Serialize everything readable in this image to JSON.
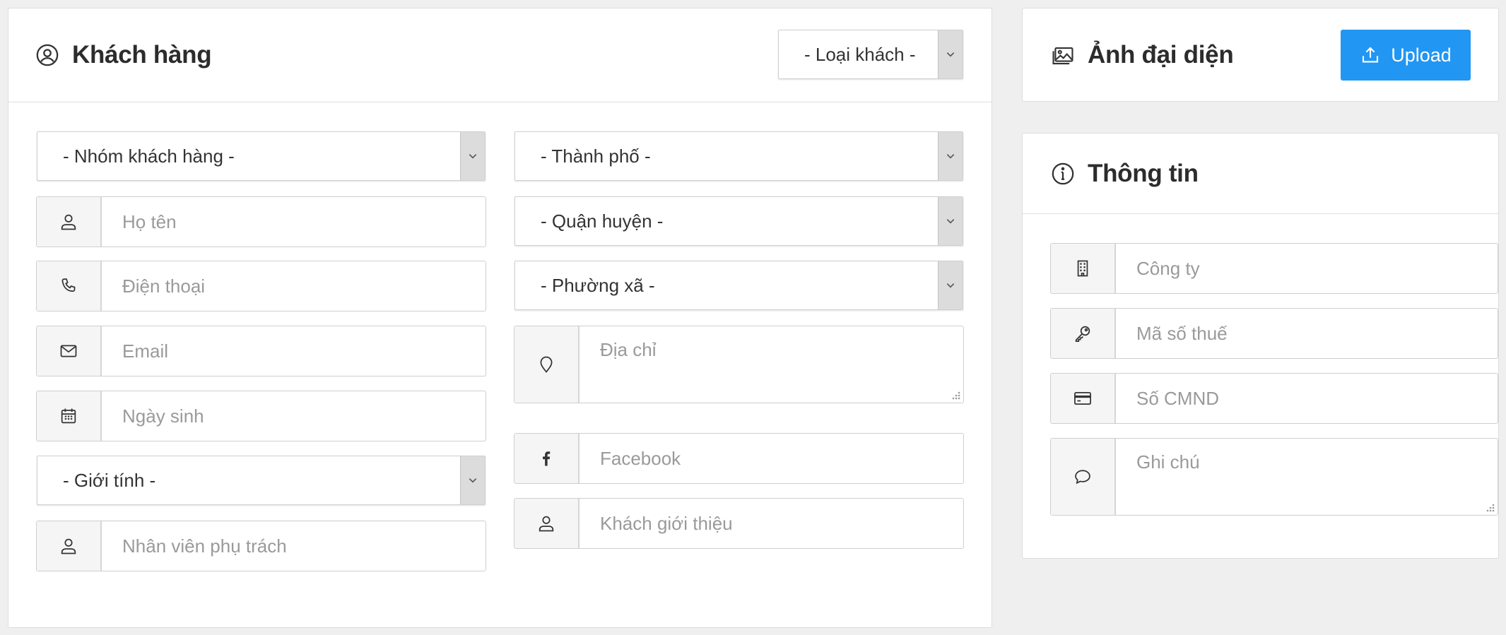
{
  "customer": {
    "title": "Khách hàng",
    "type_select": "- Loại khách -",
    "group_select": "- Nhóm khách hàng -",
    "name_placeholder": "Họ tên",
    "phone_placeholder": "Điện thoại",
    "email_placeholder": "Email",
    "birthday_placeholder": "Ngày sinh",
    "gender_select": "- Giới tính -",
    "staff_placeholder": "Nhân viên phụ trách",
    "city_select": "- Thành phố -",
    "district_select": "- Quận huyện -",
    "ward_select": "- Phường xã -",
    "address_placeholder": "Địa chỉ",
    "facebook_placeholder": "Facebook",
    "referrer_placeholder": "Khách giới thiệu"
  },
  "avatar": {
    "title": "Ảnh đại diện",
    "upload_label": "Upload"
  },
  "info": {
    "title": "Thông tin",
    "company_placeholder": "Công ty",
    "tax_placeholder": "Mã số thuế",
    "id_placeholder": "Số CMND",
    "note_placeholder": "Ghi chú"
  },
  "colors": {
    "accent": "#2196f3",
    "background": "#efefef"
  },
  "icons": [
    "user-circle-icon",
    "user-icon",
    "phone-icon",
    "envelope-icon",
    "calendar-icon",
    "map-pin-icon",
    "facebook-icon",
    "image-icon",
    "upload-icon",
    "info-icon",
    "building-icon",
    "key-icon",
    "credit-card-icon",
    "comment-icon",
    "chevron-down-icon"
  ]
}
